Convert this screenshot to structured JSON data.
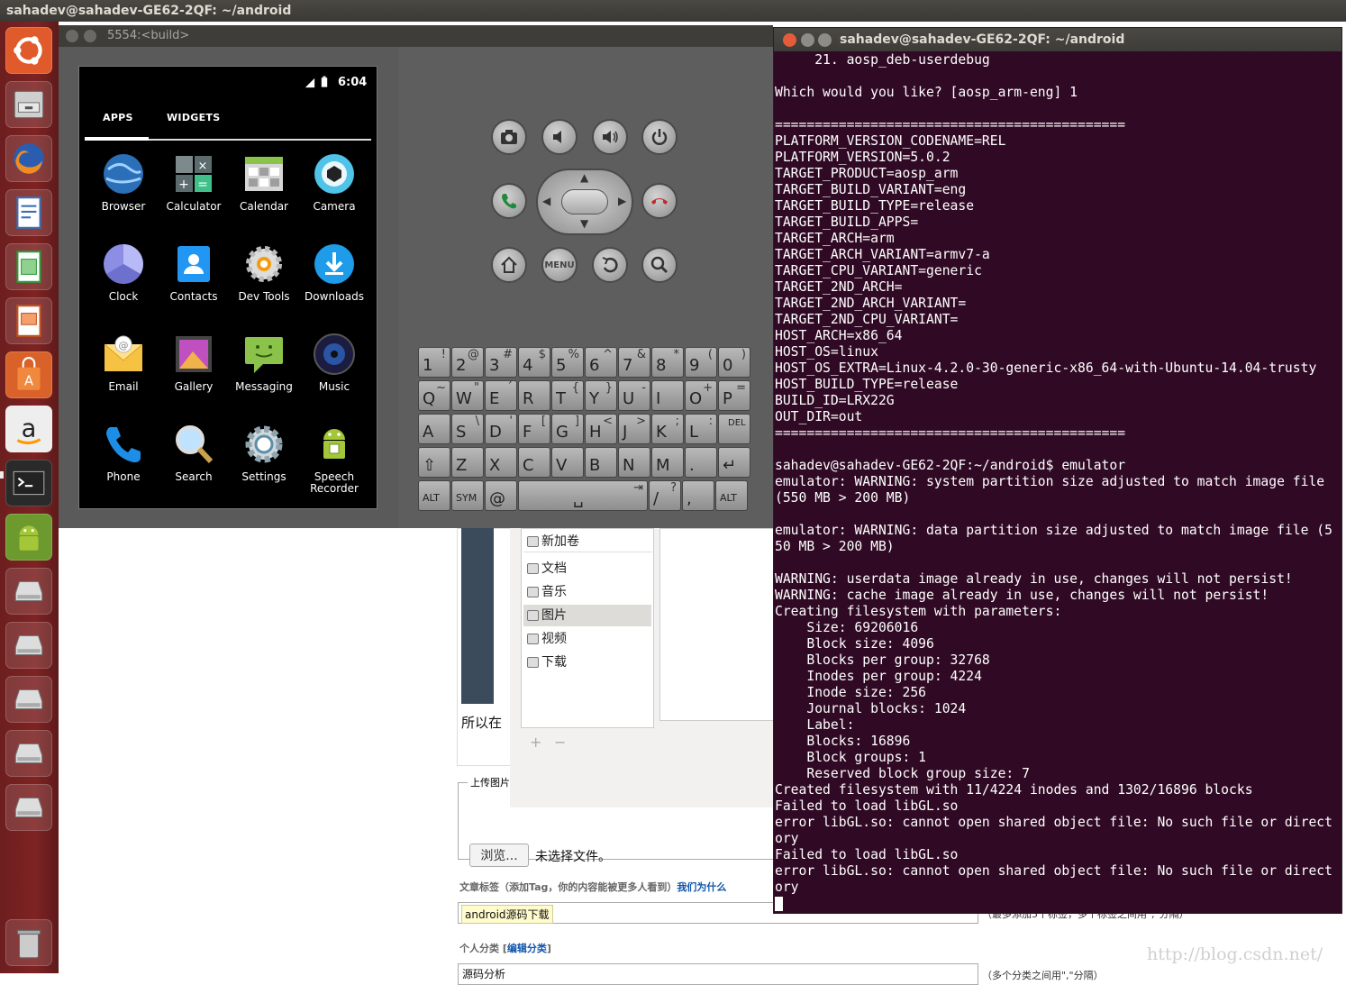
{
  "topbar": {
    "title": "sahadev@sahadev-GE62-2QF: ~/android"
  },
  "launcher": {
    "items": [
      "ubuntu-logo",
      "files",
      "firefox",
      "writer",
      "calc",
      "impress",
      "software-center",
      "amazon",
      "terminal",
      "android-sdk",
      "drive",
      "drive",
      "drive",
      "drive",
      "drive",
      "drive",
      "trash"
    ]
  },
  "emulator": {
    "title": "5554:<build>",
    "time": "6:04",
    "tabs": [
      "APPS",
      "WIDGETS"
    ],
    "apps": [
      {
        "label": "Browser",
        "icon": "browser-icon"
      },
      {
        "label": "Calculator",
        "icon": "calculator-icon"
      },
      {
        "label": "Calendar",
        "icon": "calendar-icon"
      },
      {
        "label": "Camera",
        "icon": "camera-icon"
      },
      {
        "label": "Clock",
        "icon": "clock-icon"
      },
      {
        "label": "Contacts",
        "icon": "contacts-icon"
      },
      {
        "label": "Dev Tools",
        "icon": "dev-tools-icon"
      },
      {
        "label": "Downloads",
        "icon": "downloads-icon"
      },
      {
        "label": "Email",
        "icon": "email-icon"
      },
      {
        "label": "Gallery",
        "icon": "gallery-icon"
      },
      {
        "label": "Messaging",
        "icon": "messaging-icon"
      },
      {
        "label": "Music",
        "icon": "music-icon"
      },
      {
        "label": "Phone",
        "icon": "phone-icon"
      },
      {
        "label": "Search",
        "icon": "search-icon"
      },
      {
        "label": "Settings",
        "icon": "settings-icon"
      },
      {
        "label": "Speech Recorder",
        "icon": "speech-recorder-icon"
      }
    ],
    "controls": {
      "menu": "MENU"
    },
    "keyboard": {
      "row1": [
        [
          "1",
          "!"
        ],
        [
          "2",
          "@"
        ],
        [
          "3",
          "#"
        ],
        [
          "4",
          "$"
        ],
        [
          "5",
          "%"
        ],
        [
          "6",
          "^"
        ],
        [
          "7",
          "&"
        ],
        [
          "8",
          "*"
        ],
        [
          "9",
          "("
        ],
        [
          "0",
          ")"
        ]
      ],
      "row2": [
        [
          "Q",
          "~"
        ],
        [
          "W",
          "\""
        ],
        [
          "E",
          "´"
        ],
        [
          "R",
          ""
        ],
        [
          "T",
          "{"
        ],
        [
          "Y",
          "}"
        ],
        [
          "U",
          "-"
        ],
        [
          "I",
          ""
        ],
        [
          "O",
          "+"
        ],
        [
          "P",
          "="
        ]
      ],
      "row3": [
        [
          "A",
          ""
        ],
        [
          "S",
          "\\"
        ],
        [
          "D",
          "'"
        ],
        [
          "F",
          "["
        ],
        [
          "G",
          "]"
        ],
        [
          "H",
          "<"
        ],
        [
          "J",
          ">"
        ],
        [
          "K",
          ";"
        ],
        [
          "L",
          ":"
        ],
        [
          "DEL",
          ""
        ]
      ],
      "row4": [
        [
          "⇧",
          ""
        ],
        [
          "Z",
          ""
        ],
        [
          "X",
          ""
        ],
        [
          "C",
          ""
        ],
        [
          "V",
          ""
        ],
        [
          "B",
          ""
        ],
        [
          "N",
          ""
        ],
        [
          "M",
          ""
        ],
        [
          ".",
          ""
        ],
        [
          "↵",
          ""
        ]
      ],
      "row5": [
        [
          "ALT",
          ""
        ],
        [
          "SYM",
          ""
        ],
        [
          "@",
          ""
        ],
        [
          "␣",
          "⇥"
        ],
        [
          "/",
          "?"
        ],
        [
          ",",
          ""
        ],
        [
          "ALT",
          ""
        ]
      ]
    }
  },
  "terminal": {
    "title": "sahadev@sahadev-GE62-2QF: ~/android",
    "lines": [
      "     21. aosp_deb-userdebug",
      "",
      "Which would you like? [aosp_arm-eng] 1",
      "",
      "============================================",
      "PLATFORM_VERSION_CODENAME=REL",
      "PLATFORM_VERSION=5.0.2",
      "TARGET_PRODUCT=aosp_arm",
      "TARGET_BUILD_VARIANT=eng",
      "TARGET_BUILD_TYPE=release",
      "TARGET_BUILD_APPS=",
      "TARGET_ARCH=arm",
      "TARGET_ARCH_VARIANT=armv7-a",
      "TARGET_CPU_VARIANT=generic",
      "TARGET_2ND_ARCH=",
      "TARGET_2ND_ARCH_VARIANT=",
      "TARGET_2ND_CPU_VARIANT=",
      "HOST_ARCH=x86_64",
      "HOST_OS=linux",
      "HOST_OS_EXTRA=Linux-4.2.0-30-generic-x86_64-with-Ubuntu-14.04-trusty",
      "HOST_BUILD_TYPE=release",
      "BUILD_ID=LRX22G",
      "OUT_DIR=out",
      "============================================",
      "",
      "sahadev@sahadev-GE62-2QF:~/android$ emulator",
      "emulator: WARNING: system partition size adjusted to match image file",
      "(550 MB > 200 MB)",
      "",
      "emulator: WARNING: data partition size adjusted to match image file (5",
      "50 MB > 200 MB)",
      "",
      "WARNING: userdata image already in use, changes will not persist!",
      "WARNING: cache image already in use, changes will not persist!",
      "Creating filesystem with parameters:",
      "    Size: 69206016",
      "    Block size: 4096",
      "    Blocks per group: 32768",
      "    Inodes per group: 4224",
      "    Inode size: 256",
      "    Journal blocks: 1024",
      "    Label:",
      "    Blocks: 16896",
      "    Block groups: 1",
      "    Reserved block group size: 7",
      "Created filesystem with 11/4224 inodes and 1302/16896 blocks",
      "Failed to load libGL.so",
      "error libGL.so: cannot open shared object file: No such file or direct",
      "ory",
      "Failed to load libGL.so",
      "error libGL.so: cannot open shared object file: No such file or direct",
      "ory"
    ]
  },
  "filemanager": {
    "items": [
      "新加卷",
      "文档",
      "音乐",
      "图片",
      "视频",
      "下载"
    ],
    "plus": "+",
    "minus": "−"
  },
  "webpage": {
    "fragment": "所以在",
    "upload_legend": "上传图片",
    "browse_button": "浏览...",
    "no_file": "未选择文件。",
    "tags_label": "文章标签（添加Tag，你的内容能被更多人看到）",
    "tags_link": "我们为什么",
    "tag_value": "android源码下载",
    "tags_hint": "（最多添加5个标签，多个标签之间用\",\"分隔）",
    "category_label": "个人分类",
    "category_link": "编辑分类",
    "category_value": "源码分析",
    "category_hint": "（多个分类之间用\",\"分隔）",
    "watermark": "http://blog.csdn.net/"
  }
}
